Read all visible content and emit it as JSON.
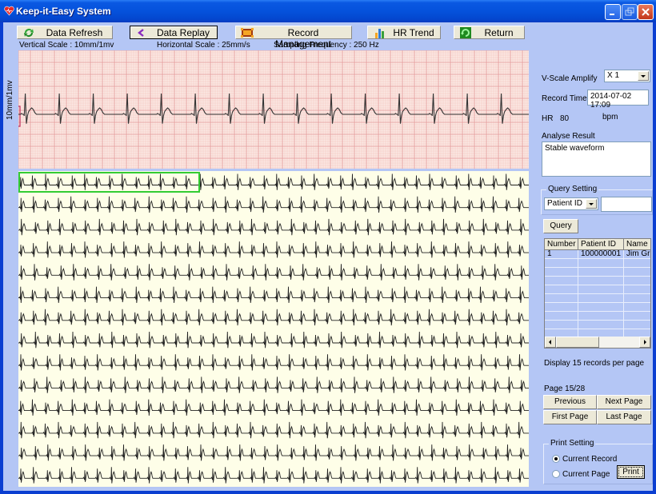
{
  "window": {
    "title": "Keep-it-Easy System",
    "controls": [
      "minimize",
      "restore",
      "close"
    ]
  },
  "toolbar": {
    "buttons": [
      {
        "label": "Data Refresh",
        "icon": "refresh-icon",
        "active": false
      },
      {
        "label": "Data Replay",
        "icon": "back-arrow-icon",
        "active": true
      },
      {
        "label": "Record Management",
        "icon": "records-icon",
        "active": false
      },
      {
        "label": "HR Trend",
        "icon": "bar-chart-icon",
        "active": false
      },
      {
        "label": "Return",
        "icon": "return-icon",
        "active": false
      }
    ]
  },
  "scales": {
    "vertical": "Vertical Scale :  10mm/1mv",
    "horizontal": "Horizontal Scale :  25mm/s",
    "sampling": "Sampling Frequency :   250 Hz"
  },
  "ecg": {
    "calibration_label": "10mm/1mv",
    "grid_color": "#f0a0a0",
    "trace_color": "#333333",
    "overview_bg": "#fefee8",
    "selection_color": "#33cc33",
    "overview_rows": 14
  },
  "panel": {
    "vscale_label": "V-Scale Amplify",
    "vscale_value": "X 1",
    "record_time_label": "Record Time",
    "record_time_value": "2014-07-02 17:09",
    "hr_label": "HR",
    "hr_value": "80",
    "hr_unit": "bpm",
    "analyse_label": "Analyse Result",
    "analyse_value": "Stable waveform",
    "query_group": "Query Setting",
    "query_field": "Patient ID",
    "query_input": "",
    "query_button": "Query",
    "table": {
      "columns": [
        "Number",
        "Patient ID",
        "Name"
      ],
      "rows": [
        [
          "1",
          "100000001",
          "Jim Grie"
        ]
      ]
    },
    "records_per_page": "Display 15 records per page",
    "page_info": "Page 15/28",
    "prev_page": "Previous Page",
    "next_page": "Next Page",
    "first_page": "First Page",
    "last_page": "Last Page",
    "print_group": "Print Setting",
    "print_current_record": "Current Record",
    "print_current_page": "Current Page",
    "print_selected": "Current Record",
    "print_button": "Print"
  }
}
